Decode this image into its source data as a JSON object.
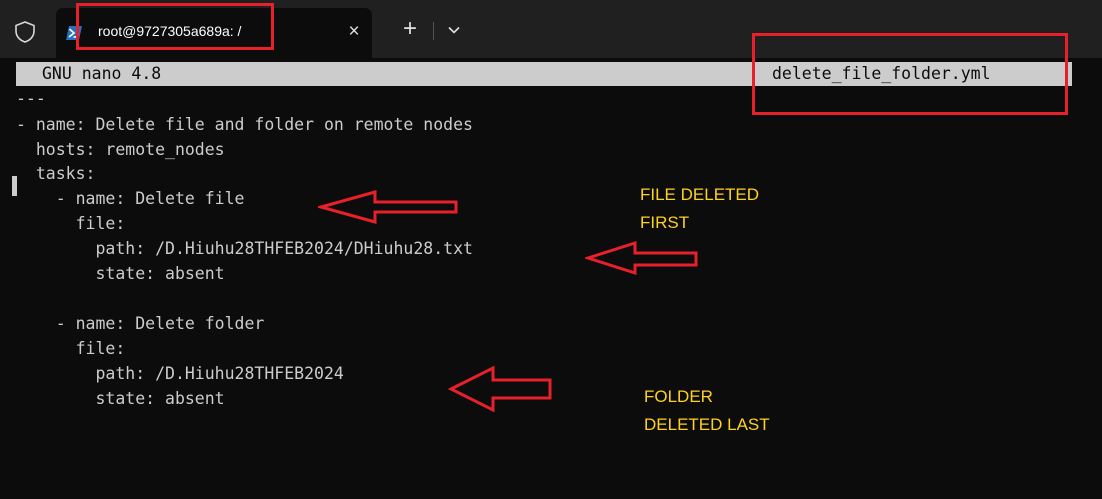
{
  "tab": {
    "title": "root@9727305a689a: /",
    "close_glyph": "×",
    "new_tab_glyph": "+"
  },
  "icons": {
    "profile": "shield-icon",
    "tab": "powershell-icon",
    "close": "close-icon",
    "new_tab": "plus-icon",
    "dropdown": "chevron-down-icon"
  },
  "nano": {
    "version": "GNU nano 4.8",
    "filename": "delete_file_folder.yml"
  },
  "editor": {
    "lines": [
      "---",
      "- name: Delete file and folder on remote nodes",
      "  hosts: remote_nodes",
      "  tasks:",
      "    - name: Delete file",
      "      file:",
      "        path: /D.Hiuhu28THFEB2024/DHiuhu28.txt",
      "        state: absent",
      "",
      "    - name: Delete folder",
      "      file:",
      "        path: /D.Hiuhu28THFEB2024",
      "        state: absent"
    ]
  },
  "annotations": {
    "file_note": [
      "FILE DELETED",
      "FIRST"
    ],
    "folder_note": [
      "FOLDER",
      "DELETED LAST"
    ]
  },
  "colors": {
    "background": "#0c0c0c",
    "tabbar": "#202020",
    "header_bg": "#cccccc",
    "text": "#cccccc",
    "annotation_red": "#e8202a",
    "annotation_yellow": "#ffd21e"
  }
}
